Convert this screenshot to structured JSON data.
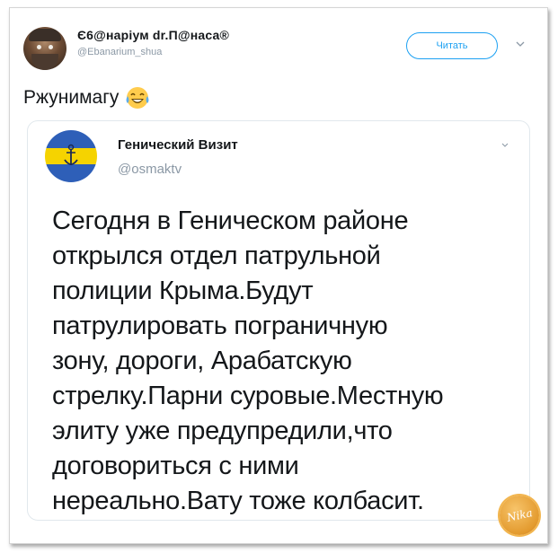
{
  "author": {
    "display_name": "Є6@наріум dr.П@наса®",
    "handle": "@Ebanarium_shua"
  },
  "follow_button": {
    "label": "Читать"
  },
  "tweet": {
    "text": "Ржунимагу",
    "emoji": "face-with-tears-of-joy"
  },
  "quoted": {
    "display_name": "Генический Визит",
    "handle": "@osmaktv",
    "lines": [
      "Сегодня в Геническом районе",
      "открылся отдел патрульной",
      "полиции Крыма.Будут",
      "патрулировать пограничную",
      "зону, дороги, Арабатскую",
      "стрелку.Парни суровые.Местную",
      "элиту уже предупредили,что",
      "договориться с ними",
      "нереально.Вату тоже колбасит."
    ]
  },
  "watermark": {
    "text": "Nika"
  },
  "colors": {
    "accent": "#1da1f2",
    "muted": "#8b98a5",
    "text": "#14171a",
    "flag_blue": "#2e5fb8",
    "flag_yellow": "#f5d300"
  }
}
